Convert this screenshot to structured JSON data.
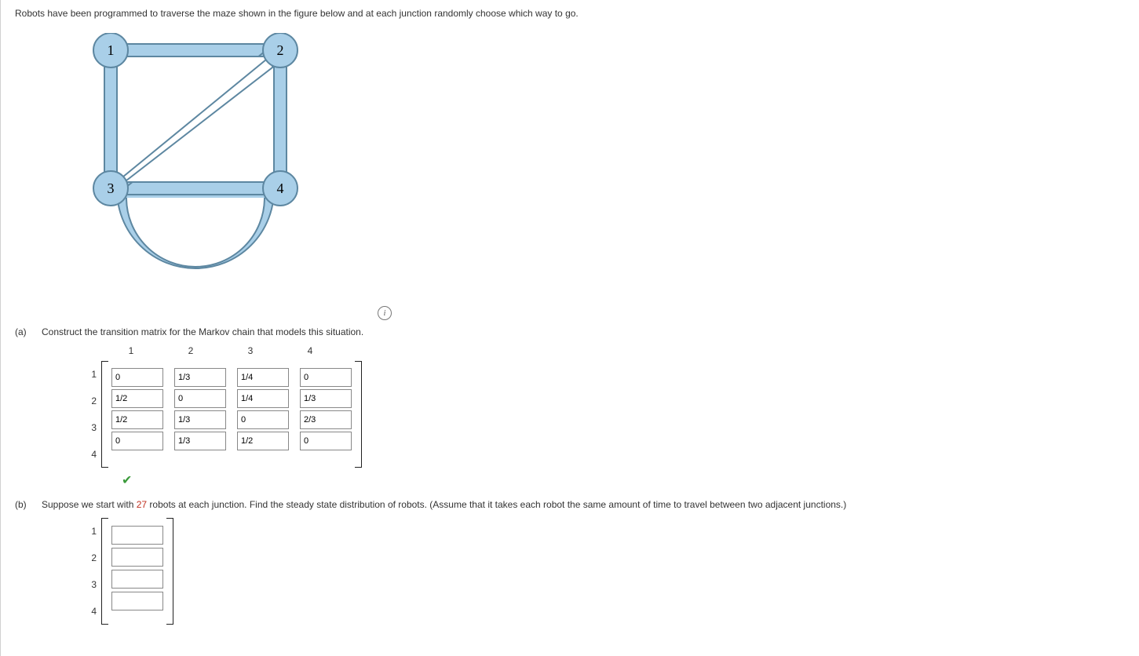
{
  "intro": "Robots have been programmed to traverse the maze shown in the figure below and at each junction randomly choose which way to go.",
  "nodes": {
    "n1": "1",
    "n2": "2",
    "n3": "3",
    "n4": "4"
  },
  "info_title": "Show figure info",
  "part_a": {
    "label": "(a)",
    "instr": "Construct the transition matrix for the Markov chain that models this situation.",
    "col_h": [
      "1",
      "2",
      "3",
      "4"
    ],
    "row_h": [
      "1",
      "2",
      "3",
      "4"
    ],
    "matrix": [
      [
        "0",
        "1/3",
        "1/4",
        "0"
      ],
      [
        "1/2",
        "0",
        "1/4",
        "1/3"
      ],
      [
        "1/2",
        "1/3",
        "0",
        "2/3"
      ],
      [
        "0",
        "1/3",
        "1/2",
        "0"
      ]
    ],
    "check_title": "Correct"
  },
  "part_b": {
    "label": "(b)",
    "instr_pre": "Suppose we start with ",
    "count": "27",
    "instr_post": " robots at each junction. Find the steady state distribution of robots. (Assume that it takes each robot the same amount of time to travel between two adjacent junctions.)",
    "row_h": [
      "1",
      "2",
      "3",
      "4"
    ],
    "values": [
      "",
      "",
      "",
      ""
    ]
  }
}
